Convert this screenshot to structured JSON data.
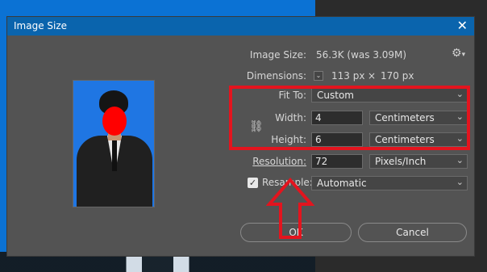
{
  "window": {
    "title": "Image Size",
    "close": "✕"
  },
  "image_size": {
    "label": "Image Size:",
    "value": "56.3K (was 3.09M)"
  },
  "dimensions": {
    "label": "Dimensions:",
    "width": "113 px",
    "times": "×",
    "height": "170 px"
  },
  "fit_to": {
    "label": "Fit To:",
    "value": "Custom"
  },
  "width": {
    "label": "Width:",
    "value": "4",
    "unit": "Centimeters"
  },
  "height": {
    "label": "Height:",
    "value": "6",
    "unit": "Centimeters"
  },
  "resolution": {
    "label": "Resolution:",
    "value": "72",
    "unit": "Pixels/Inch"
  },
  "resample": {
    "label": "Resample:",
    "checked": true,
    "value": "Automatic"
  },
  "buttons": {
    "ok": "OK",
    "cancel": "Cancel"
  },
  "icons": {
    "gear": "gear-icon",
    "link": "link-icon",
    "chevron": "chevron-down-icon",
    "checkmark": "checkmark-icon"
  },
  "colors": {
    "accent": "#0a64ad",
    "dialog_bg": "#535353",
    "highlight": "#e3141e",
    "photo_bg": "#1f76e3",
    "face": "#ff0000"
  }
}
